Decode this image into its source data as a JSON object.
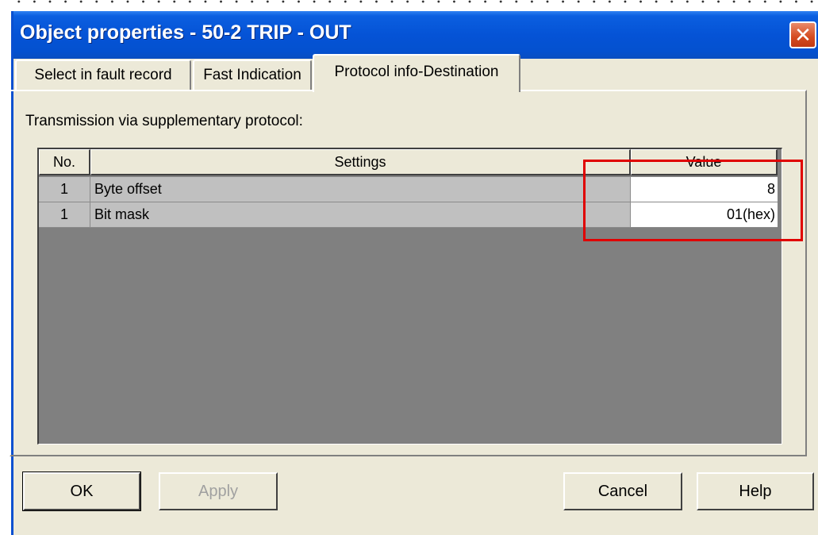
{
  "window": {
    "title": "Object properties - 50-2 TRIP - OUT",
    "close_glyph": "✕"
  },
  "tabs": [
    {
      "label": "Select in fault record",
      "active": false
    },
    {
      "label": "Fast Indication",
      "active": false
    },
    {
      "label": "Protocol info-Destination",
      "active": true
    }
  ],
  "panel": {
    "caption": "Transmission via supplementary protocol:"
  },
  "table": {
    "columns": [
      "No.",
      "Settings",
      "Value"
    ],
    "rows": [
      {
        "no": "1",
        "setting": "Byte offset",
        "value": "8"
      },
      {
        "no": "1",
        "setting": "Bit mask",
        "value": "01(hex)"
      }
    ]
  },
  "highlight": {
    "color": "#e00000",
    "target": "Value column"
  },
  "buttons": {
    "ok": "OK",
    "apply": "Apply",
    "cancel": "Cancel",
    "help": "Help"
  },
  "colors": {
    "titlebar": "#0553d6",
    "dialog_bg": "#ece9d8",
    "grid_bg": "#808080",
    "close_button": "#d44a20"
  }
}
